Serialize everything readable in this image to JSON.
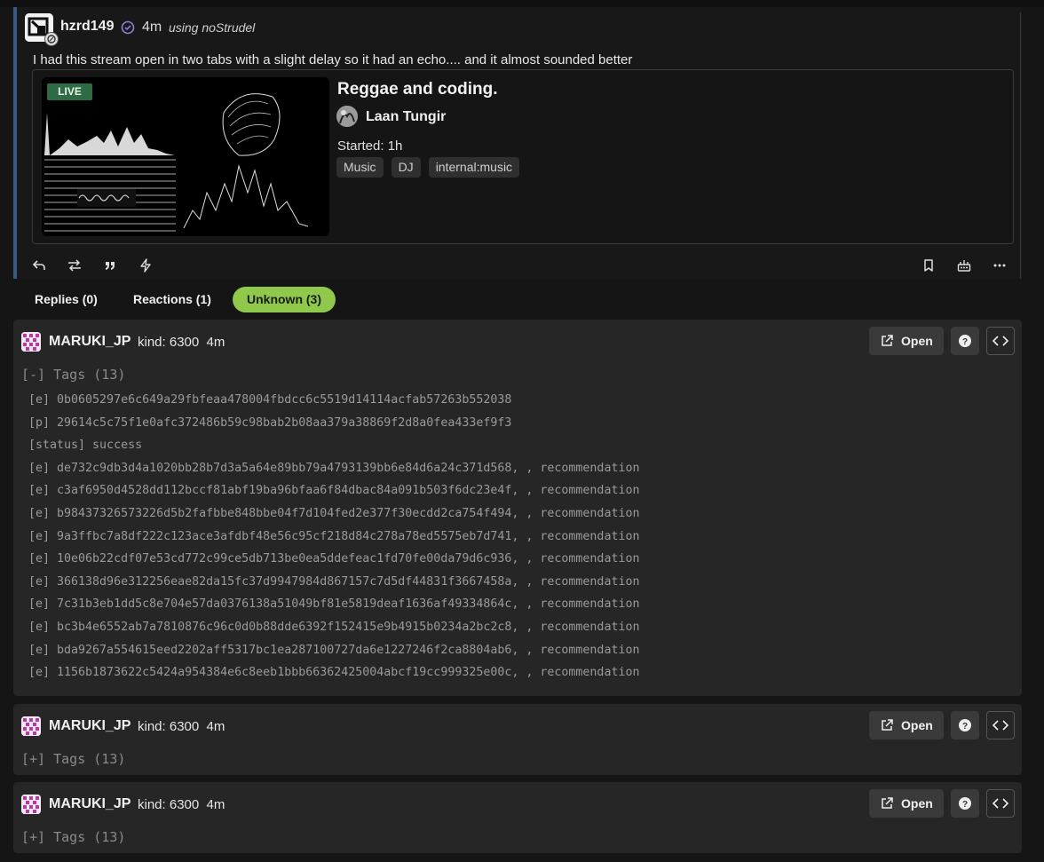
{
  "note": {
    "author": "hzrd149",
    "time": "4m",
    "client": "using noStrudel",
    "text": "I had this stream open in two tabs with a slight delay so it had an echo.... and it almost sounded better",
    "embed": {
      "live_label": "LIVE",
      "title": "Reggae and coding.",
      "host": "Laan Tungir",
      "started": "Started: 1h",
      "tags": [
        "Music",
        "DJ",
        "internal:music"
      ]
    }
  },
  "tabs": [
    {
      "label": "Replies (0)",
      "active": false
    },
    {
      "label": "Reactions (1)",
      "active": false
    },
    {
      "label": "Unknown (3)",
      "active": true
    }
  ],
  "events": [
    {
      "name": "MARUKI_JP",
      "meta": "kind: 6300  4m",
      "open_label": "Open",
      "tags_toggle": "[-] Tags (13)",
      "tags": [
        "[e] 0b0605297e6c649a29fbfeaa478004fbdcc6c5519d14114acfab57263b552038",
        "[p] 29614c5c75f1e0afc372486b59c98bab2b08aa379a38869f2d8a0fea433ef9f3",
        "[status] success",
        "[e] de732c9db3d4a1020bb28b7d3a5a64e89bb79a4793139bb6e84d6a24c371d568, , recommendation",
        "[e] c3af6950d4528dd112bccf81abf19ba96bfaa6f84dbac84a091b503f6dc23e4f, , recommendation",
        "[e] b98437326573226d5b2fafbbe848bbe04f7d104fed2e377f30ecdd2ca754f494, , recommendation",
        "[e] 9a3ffbc7a8df222c123ace3afdbf48e56c95cf218d84c278a78ed5575eb7d741, , recommendation",
        "[e] 10e06b22cdf07e53cd772c99ce5db713be0ea5ddefeac1fd70fe00da79d6c936, , recommendation",
        "[e] 366138d96e312256eae82da15fc37d9947984d867157c7d5df44831f3667458a, , recommendation",
        "[e] 7c31b3eb1dd5c8e704e57da0376138a51049bf81e5819deaf1636af49334864c, , recommendation",
        "[e] bc3b4e6552ab7a7810876c96c0d0b88dde6392f152415e9b4915b0234a2bc2c8, , recommendation",
        "[e] bda9267a554615eed2202aff5317bc1ea287100727da6e1227246f2ca8804ab6, , recommendation",
        "[e] 1156b1873622c5424a954384e6c8eeb1bbb66362425004abcf19cc999325e00c, , recommendation"
      ]
    },
    {
      "name": "MARUKI_JP",
      "meta": "kind: 6300  4m",
      "open_label": "Open",
      "tags_toggle": "[+] Tags (13)"
    },
    {
      "name": "MARUKI_JP",
      "meta": "kind: 6300  4m",
      "open_label": "Open",
      "tags_toggle": "[+] Tags (13)"
    }
  ],
  "icons": {
    "note_actions_left": [
      "reply-icon",
      "repost-icon",
      "quote-icon",
      "zap-icon"
    ],
    "note_actions_right": [
      "bookmark-icon",
      "broadcast-icon",
      "more-icon"
    ],
    "event_buttons": [
      "external-link-icon",
      "help-icon",
      "code-icon"
    ]
  },
  "colors": {
    "accent": "#8fc84a",
    "note_border": "#3a5a86",
    "live_badge": "#2e6b45",
    "card_bg": "#262626",
    "page_bg": "#151515"
  }
}
